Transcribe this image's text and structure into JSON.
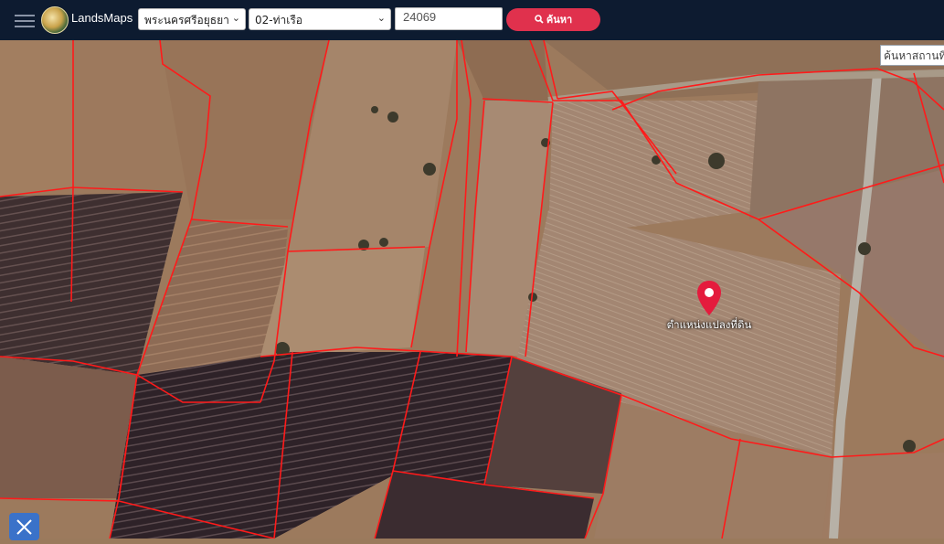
{
  "header": {
    "menu_icon": "hamburger-menu-icon",
    "logo_icon": "lands-department-seal-icon",
    "brand": "LandsMaps",
    "province_select": "พระนครศรีอยุธยา",
    "district_select": "02-ท่าเรือ",
    "parcel_input": "24069",
    "search_label": "ค้นหา",
    "search_icon": "magnifier-icon"
  },
  "map": {
    "place_search_placeholder": "ค้นหาสถานที่",
    "marker_label": "ตำแหน่งแปลงที่ดิน",
    "marker_icon": "map-pin-icon",
    "tool_icon": "measure-tool-icon",
    "boundary_color": "#ff1a1a",
    "marker_color": "#e41b3d"
  },
  "colors": {
    "header_bg": "#0d1b30",
    "search_button": "#e0314d"
  }
}
